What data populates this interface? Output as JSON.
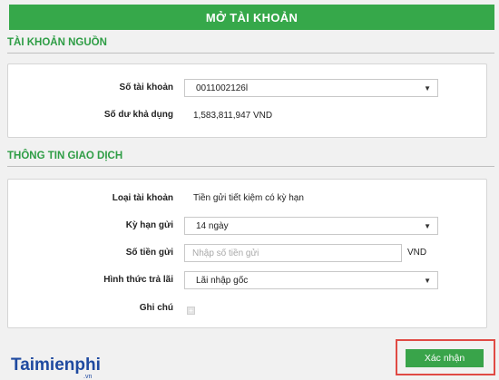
{
  "header": {
    "title": "MỞ TÀI KHOẢN"
  },
  "source_account": {
    "section_title": "TÀI KHOẢN NGUỒN",
    "account_number_label": "Số tài khoản",
    "account_number_value": "0011002126l",
    "available_balance_label": "Số dư khả dụng",
    "available_balance_value": "1,583,811,947 VND"
  },
  "transaction_info": {
    "section_title": "THÔNG TIN GIAO DỊCH",
    "account_type_label": "Loại tài khoản",
    "account_type_value": "Tiền gửi tiết kiệm có kỳ hạn",
    "term_label": "Kỳ hạn gửi",
    "term_value": "14 ngày",
    "amount_label": "Số tiền gửi",
    "amount_placeholder": "Nhập số tiền gửi",
    "amount_unit": "VND",
    "payout_label": "Hình thức trả lãi",
    "payout_value": "Lãi nhập gốc",
    "note_label": "Ghi chú"
  },
  "actions": {
    "confirm_label": "Xác nhận"
  },
  "logo": {
    "brand": "Taimienphi",
    "domain": ".vn"
  },
  "colors": {
    "accent": "#36a84a",
    "highlight_border": "#e04a44"
  },
  "icons": {
    "dropdown": "triangle-down-icon",
    "expand": "plus-icon"
  }
}
